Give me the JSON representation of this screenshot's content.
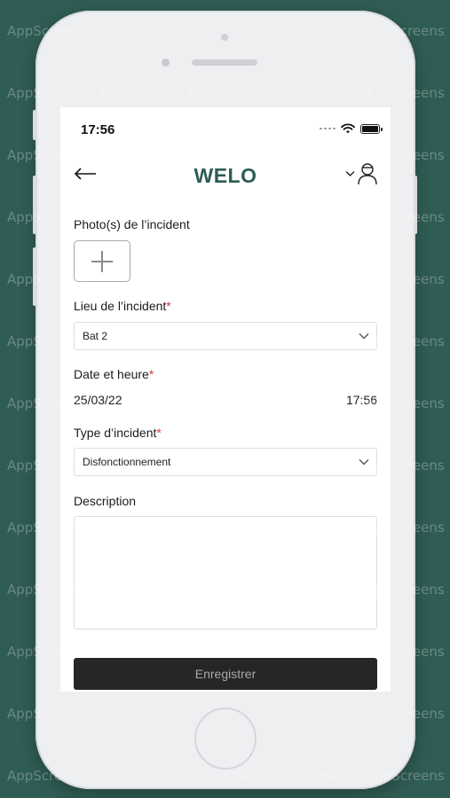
{
  "status_bar": {
    "time": "17:56"
  },
  "header": {
    "title": "WELO",
    "brand_color": "#2d5d53"
  },
  "form": {
    "photos_label": "Photo(s) de l’incident",
    "location_label": "Lieu de l’incident",
    "location_value": "Bat 2",
    "datetime_label": "Date et heure",
    "date_value": "25/03/22",
    "time_value": "17:56",
    "type_label": "Type d’incident",
    "type_value": "Disfonctionnement",
    "description_label": "Description",
    "required_marker": "*",
    "required_color": "#e0343a"
  },
  "footer": {
    "save_label": "Enregistrer"
  },
  "watermark": {
    "text": "AppScreens"
  },
  "icons": [
    "back-arrow-icon",
    "chevron-down-icon",
    "user-icon",
    "plus-icon",
    "wifi-icon",
    "battery-icon",
    "signal-icon"
  ]
}
